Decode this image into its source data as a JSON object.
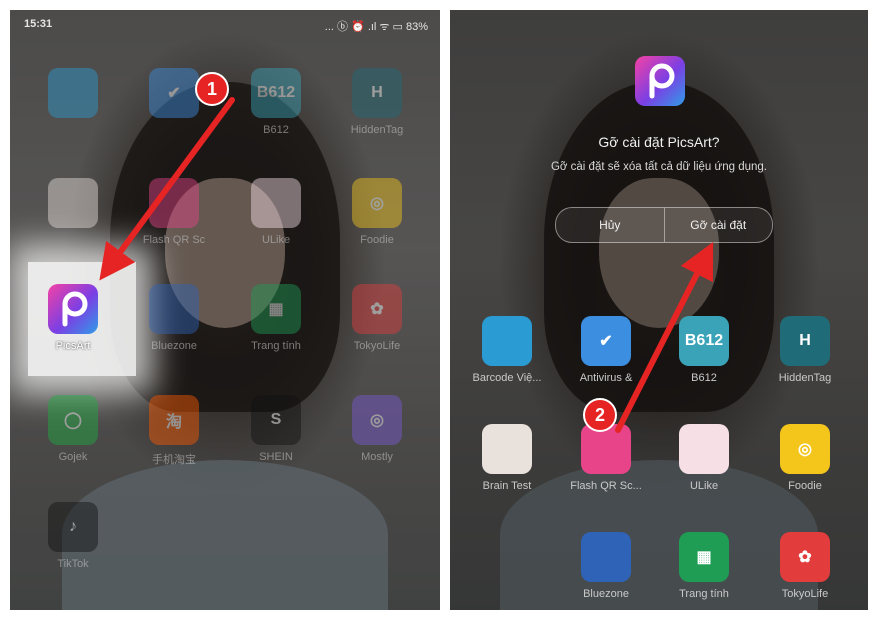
{
  "left_screen": {
    "status": {
      "time": "15:31",
      "indicators": "... ⓑ ⏰ .ıl ᯤ ▭ 83%",
      "battery": "83%"
    },
    "apps": [
      {
        "label": "",
        "icon": "barcode-scanner-icon",
        "color": "#2b9bd3",
        "glyph": ""
      },
      {
        "label": "",
        "icon": "shield-check-icon",
        "color": "#3c8ee0",
        "glyph": "✔"
      },
      {
        "label": "B612",
        "icon": "b612-icon",
        "color": "#3aa3b8",
        "glyph": "B612"
      },
      {
        "label": "HiddenTag",
        "icon": "hiddentag-icon",
        "color": "#1f6b78",
        "glyph": "H"
      },
      {
        "label": "",
        "icon": "brain-icon",
        "color": "#e9e1dc",
        "glyph": ""
      },
      {
        "label": "Flash QR Sc",
        "icon": "flash-qr-icon",
        "color": "#e8448a",
        "glyph": ""
      },
      {
        "label": "ULike",
        "icon": "ulike-icon",
        "color": "#f7dfe6",
        "glyph": ""
      },
      {
        "label": "Foodie",
        "icon": "foodie-icon",
        "color": "#f4c61c",
        "glyph": "◎"
      },
      {
        "label": "PicsArt",
        "icon": "picsart-icon",
        "color": "#c33bd6",
        "glyph": ""
      },
      {
        "label": "Bluezone",
        "icon": "bluezone-icon",
        "color": "#2f63b8",
        "glyph": ""
      },
      {
        "label": "Trang tính",
        "icon": "sheets-icon",
        "color": "#1f9d55",
        "glyph": "▦"
      },
      {
        "label": "TokyoLife",
        "icon": "tokyolife-icon",
        "color": "#e23c3c",
        "glyph": "✿"
      },
      {
        "label": "Gojek",
        "icon": "gojek-icon",
        "color": "#1fae42",
        "glyph": "◯"
      },
      {
        "label": "手机淘宝",
        "icon": "taobao-icon",
        "color": "#ff5a00",
        "glyph": "淘"
      },
      {
        "label": "SHEIN",
        "icon": "shein-icon",
        "color": "#111111",
        "glyph": "S"
      },
      {
        "label": "Mostly",
        "icon": "spiral-icon",
        "color": "#7b59d6",
        "glyph": "◎"
      },
      {
        "label": "TikTok",
        "icon": "tiktok-icon",
        "color": "#111111",
        "glyph": "♪"
      }
    ]
  },
  "right_screen": {
    "dialog": {
      "title": "Gỡ cài đặt PicsArt?",
      "subtitle": "Gỡ cài đặt sẽ xóa tất cả dữ liệu ứng dụng.",
      "cancel_label": "Hủy",
      "confirm_label": "Gỡ cài đặt"
    },
    "apps": [
      {
        "label": "Barcode Việ...",
        "icon": "barcode-scanner-icon",
        "color": "#2b9bd3",
        "glyph": ""
      },
      {
        "label": "Antivirus &",
        "icon": "shield-check-icon",
        "color": "#3c8ee0",
        "glyph": "✔"
      },
      {
        "label": "B612",
        "icon": "b612-icon",
        "color": "#3aa3b8",
        "glyph": "B612"
      },
      {
        "label": "HiddenTag",
        "icon": "hiddentag-icon",
        "color": "#1f6b78",
        "glyph": "H"
      },
      {
        "label": "Brain Test",
        "icon": "brain-icon",
        "color": "#e9e1dc",
        "glyph": ""
      },
      {
        "label": "Flash QR Sc...",
        "icon": "flash-qr-icon",
        "color": "#e8448a",
        "glyph": ""
      },
      {
        "label": "ULike",
        "icon": "ulike-icon",
        "color": "#f7dfe6",
        "glyph": ""
      },
      {
        "label": "Foodie",
        "icon": "foodie-icon",
        "color": "#f4c61c",
        "glyph": "◎"
      },
      {
        "label": "Bluezone",
        "icon": "bluezone-icon",
        "color": "#2f63b8",
        "glyph": ""
      },
      {
        "label": "Trang tính",
        "icon": "sheets-icon",
        "color": "#1f9d55",
        "glyph": "▦"
      },
      {
        "label": "TokyoLife",
        "icon": "tokyolife-icon",
        "color": "#e23c3c",
        "glyph": "✿"
      }
    ]
  },
  "annotations": {
    "step_1": "1",
    "step_2": "2",
    "arrow_color": "#e62424"
  }
}
